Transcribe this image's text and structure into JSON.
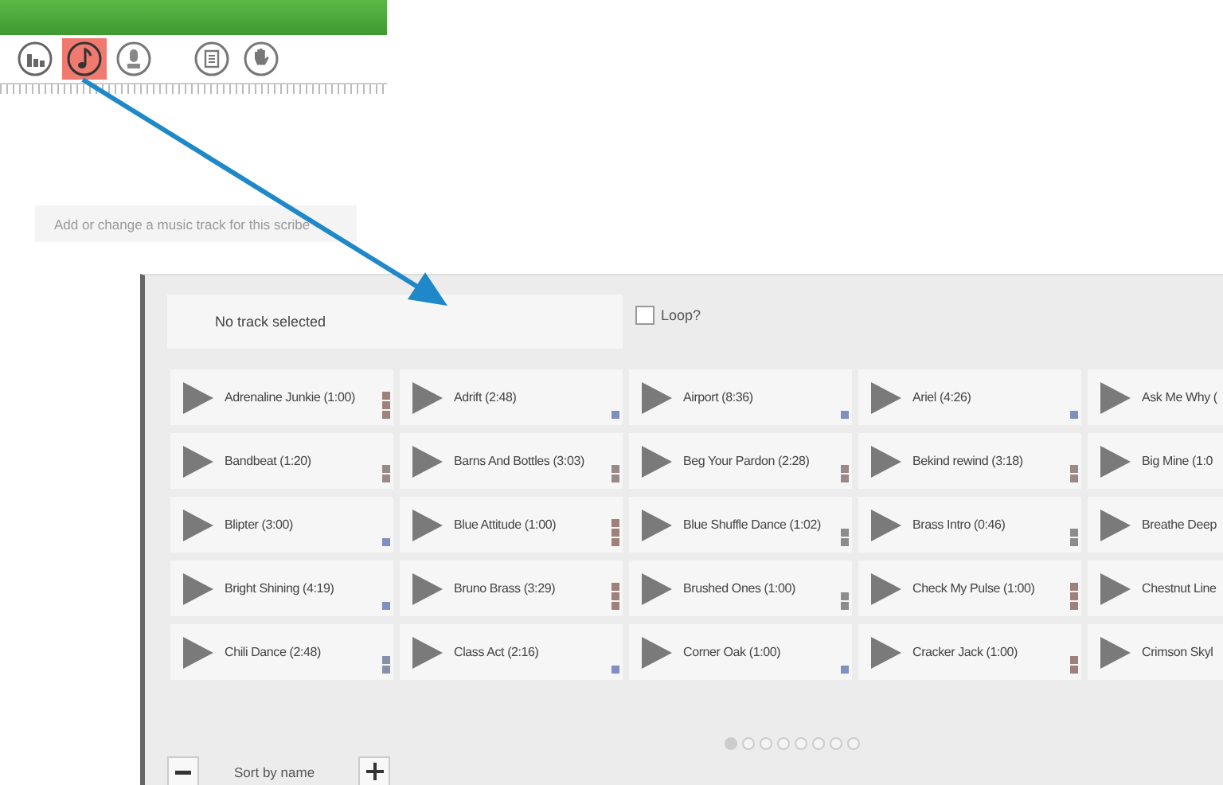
{
  "toolbar": {
    "tools": [
      {
        "kind": "chart",
        "selected": false
      },
      {
        "kind": "music",
        "selected": true
      },
      {
        "kind": "microphone",
        "selected": false
      },
      {
        "kind": "document",
        "selected": false
      },
      {
        "kind": "hand",
        "selected": false
      }
    ]
  },
  "tooltip": "Add or change a music track for this scribe",
  "track_field": {
    "value": "No track selected"
  },
  "loop": {
    "label": "Loop?",
    "checked": false
  },
  "tracks": [
    {
      "title": "Adrenaline Junkie (1:00)",
      "kind": "three",
      "color": "#a0807a"
    },
    {
      "title": "Adrift (2:48)",
      "kind": "one",
      "color": "#7f90c0"
    },
    {
      "title": "Airport (8:36)",
      "kind": "one",
      "color": "#7f90c0"
    },
    {
      "title": "Ariel (4:26)",
      "kind": "one",
      "color": "#7f90c0"
    },
    {
      "title": "Ask Me Why (",
      "kind": "none"
    },
    {
      "title": "Bandbeat (1:20)",
      "kind": "two",
      "color": "#998a88"
    },
    {
      "title": "Barns And Bottles (3:03)",
      "kind": "two",
      "color": "#998a88"
    },
    {
      "title": "Beg Your Pardon (2:28)",
      "kind": "two",
      "color": "#998a88"
    },
    {
      "title": "Bekind rewind (3:18)",
      "kind": "two",
      "color": "#998a88"
    },
    {
      "title": "Big Mine (1:0",
      "kind": "none"
    },
    {
      "title": "Blipter (3:00)",
      "kind": "one",
      "color": "#7f90c0"
    },
    {
      "title": "Blue Attitude (1:00)",
      "kind": "three",
      "color": "#a0807a"
    },
    {
      "title": "Blue Shuffle Dance (1:02)",
      "kind": "two",
      "color": "#8c8c8c"
    },
    {
      "title": "Brass Intro (0:46)",
      "kind": "two",
      "color": "#8c8c8c"
    },
    {
      "title": "Breathe Deep",
      "kind": "none"
    },
    {
      "title": "Bright Shining (4:19)",
      "kind": "one",
      "color": "#7f90c0"
    },
    {
      "title": "Bruno Brass (3:29)",
      "kind": "three",
      "color": "#a0807a"
    },
    {
      "title": "Brushed Ones (1:00)",
      "kind": "two",
      "color": "#8c8c8c"
    },
    {
      "title": "Check My Pulse (1:00)",
      "kind": "three",
      "color": "#a0807a"
    },
    {
      "title": "Chestnut Line",
      "kind": "none"
    },
    {
      "title": "Chili Dance (2:48)",
      "kind": "two",
      "color": "#8890a8"
    },
    {
      "title": "Class Act (2:16)",
      "kind": "one",
      "color": "#7f90c0"
    },
    {
      "title": "Corner Oak (1:00)",
      "kind": "one",
      "color": "#7f90c0"
    },
    {
      "title": "Cracker Jack (1:00)",
      "kind": "two",
      "color": "#a0807a"
    },
    {
      "title": "Crimson Skyl",
      "kind": "none"
    }
  ],
  "pages": [
    {
      "selected": true
    },
    {
      "selected": false
    },
    {
      "selected": false
    },
    {
      "selected": false
    },
    {
      "selected": false
    },
    {
      "selected": false
    },
    {
      "selected": false
    },
    {
      "selected": false
    }
  ],
  "sort": {
    "label": "Sort by name"
  }
}
